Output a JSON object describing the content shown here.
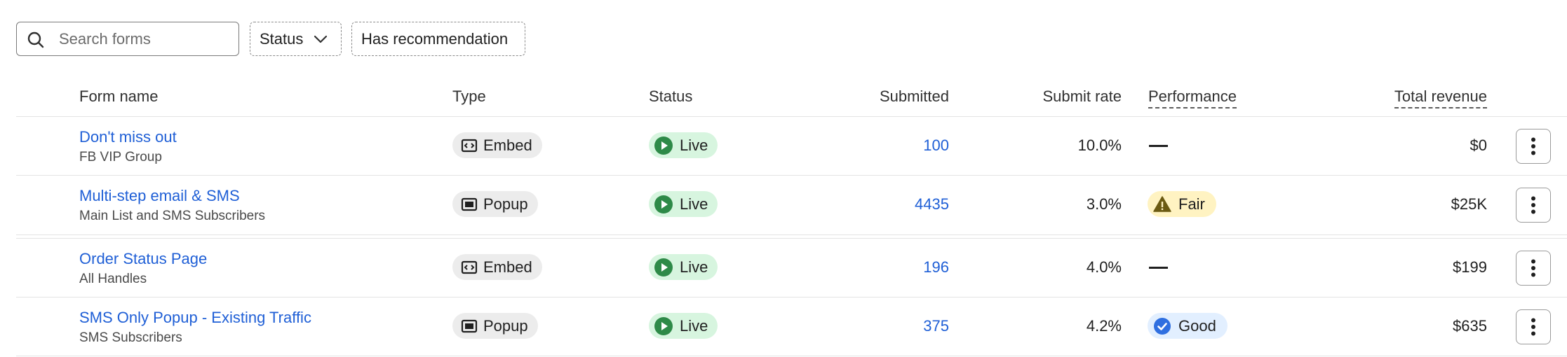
{
  "toolbar": {
    "search_placeholder": "Search forms",
    "status_filter_label": "Status",
    "recommendation_filter_label": "Has recommendation"
  },
  "table": {
    "headers": {
      "form_name": "Form name",
      "type": "Type",
      "status": "Status",
      "submitted": "Submitted",
      "submit_rate": "Submit rate",
      "performance": "Performance",
      "total_revenue": "Total revenue"
    },
    "rows": [
      {
        "name": "Don't miss out",
        "list": "FB VIP Group",
        "type": "Embed",
        "type_icon": "embed-icon",
        "status": "Live",
        "submitted": "100",
        "submit_rate": "10.0%",
        "performance": "—",
        "revenue": "$0"
      },
      {
        "name": "Multi-step email & SMS",
        "list": "Main List and SMS Subscribers",
        "type": "Popup",
        "type_icon": "popup-icon",
        "status": "Live",
        "submitted": "4435",
        "submit_rate": "3.0%",
        "performance": "Fair",
        "performance_icon": "warning-icon",
        "revenue": "$25K"
      },
      {
        "name": "Order Status Page",
        "list": "All Handles",
        "type": "Embed",
        "type_icon": "embed-icon",
        "status": "Live",
        "submitted": "196",
        "submit_rate": "4.0%",
        "performance": "—",
        "revenue": "$199"
      },
      {
        "name": "SMS Only Popup - Existing Traffic",
        "list": "SMS Subscribers",
        "type": "Popup",
        "type_icon": "popup-icon",
        "status": "Live",
        "submitted": "375",
        "submit_rate": "4.2%",
        "performance": "Good",
        "performance_icon": "check-circle-icon",
        "revenue": "$635"
      }
    ]
  },
  "colors": {
    "link": "#1f5fd6",
    "live_badge_bg": "#d7f5df",
    "live_dot": "#2e8a48",
    "fair_badge_bg": "#fff3c2",
    "good_badge_bg": "#e2efff"
  }
}
